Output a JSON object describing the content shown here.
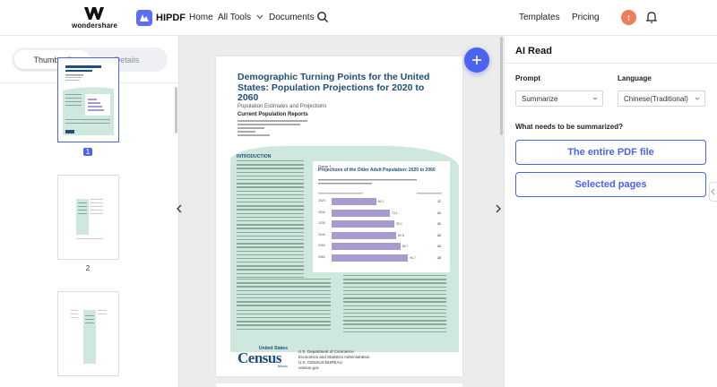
{
  "topbar": {
    "brand": "wondershare",
    "product": "HIPDF",
    "nav": {
      "home": "Home",
      "all_tools": "All Tools",
      "documents": "Documents",
      "templates": "Templates",
      "pricing": "Pricing"
    },
    "avatar_letter": "t"
  },
  "sidebar": {
    "tabs": {
      "thumbnail": "Thumbnail",
      "details": "Details"
    },
    "pages": [
      "1",
      "2"
    ]
  },
  "document": {
    "title": "Demographic Turning Points for the United States: Population Projections for 2020 to 2060",
    "subtitle": "Population Estimates and Projections",
    "series": "Current Population Reports",
    "intro_heading": "INTRODUCTION",
    "figure_label": "Figure 1.",
    "figure_title": "Projections of the Older Adult Population: 2020 to 2060",
    "bars": [
      {
        "year": "2020",
        "value": "56.1",
        "pct": "17",
        "fill": 0.42
      },
      {
        "year": "2030",
        "value": "73.1",
        "pct": "21",
        "fill": 0.55
      },
      {
        "year": "2035",
        "value": "78.0",
        "pct": "21",
        "fill": 0.59
      },
      {
        "year": "2040",
        "value": "80.8",
        "pct": "22",
        "fill": 0.61
      },
      {
        "year": "2050",
        "value": "85.7",
        "pct": "22",
        "fill": 0.65
      },
      {
        "year": "2060",
        "value": "94.7",
        "pct": "23",
        "fill": 0.72
      }
    ],
    "census_small": "United States",
    "census_big": "Census",
    "census_bureau": "Bureau",
    "footer": [
      "U.S. Department of Commerce",
      "Economics and Statistics Administration",
      "U.S. CENSUS BUREAU",
      "census.gov"
    ]
  },
  "ai_panel": {
    "title": "AI Read",
    "prompt_label": "Prompt",
    "prompt_value": "Summarize",
    "language_label": "Language",
    "language_value": "Chinese(Traditional)",
    "question": "What needs to be summarized?",
    "option_full": "The entire PDF file",
    "option_selected": "Selected pages"
  },
  "colors": {
    "accent": "#4a63f0",
    "doc_green": "#cfe8dd",
    "bar_purple": "#a89bd0",
    "doc_blue": "#1f4e79"
  }
}
